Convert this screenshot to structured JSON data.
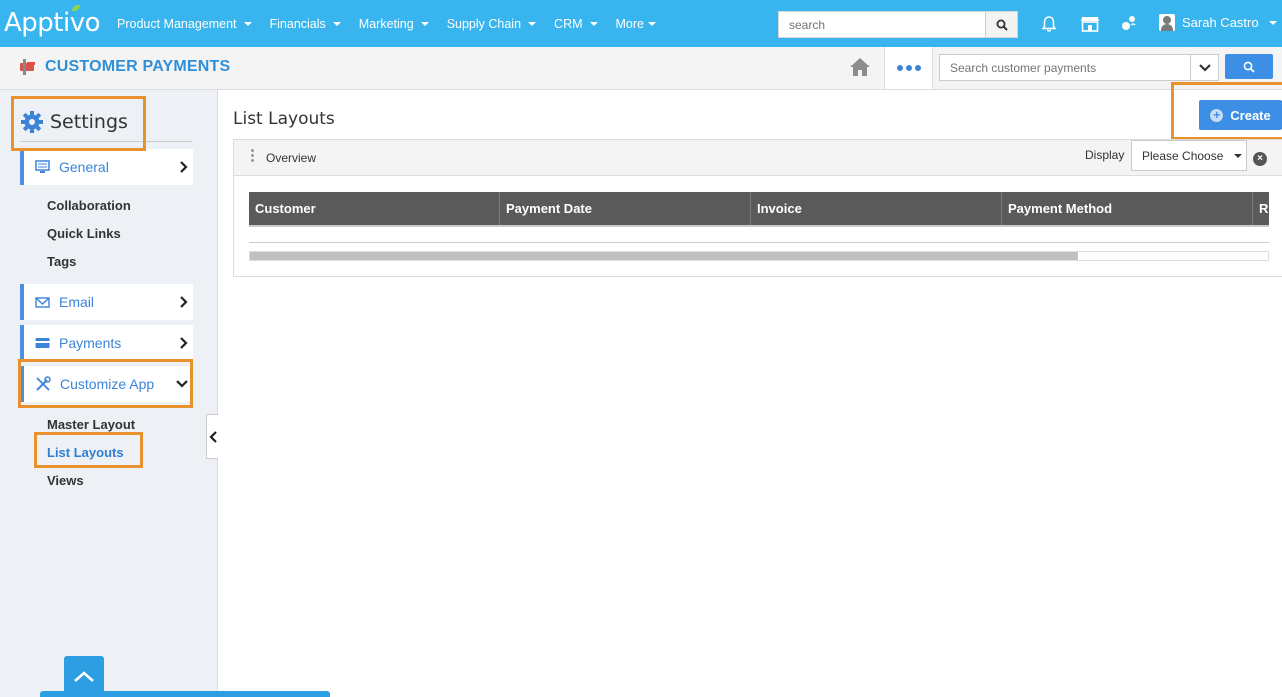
{
  "topbar": {
    "logo": "Apptivo",
    "nav": [
      "Product Management",
      "Financials",
      "Marketing",
      "Supply Chain",
      "CRM",
      "More"
    ],
    "search_placeholder": "search",
    "user_name": "Sarah Castro"
  },
  "subbar": {
    "title": "CUSTOMER PAYMENTS",
    "search_placeholder": "Search customer payments"
  },
  "sidebar": {
    "heading": "Settings",
    "general": "General",
    "general_links": [
      "Collaboration",
      "Quick Links",
      "Tags"
    ],
    "email": "Email",
    "payments": "Payments",
    "customize": "Customize App",
    "customize_links": [
      "Master Layout",
      "List Layouts",
      "Views"
    ]
  },
  "main": {
    "heading": "List Layouts",
    "create_label": "Create",
    "panel_title": "Overview",
    "display_label": "Display",
    "display_value": "Please Choose",
    "columns": [
      "Customer",
      "Payment Date",
      "Invoice",
      "Payment Method",
      "R"
    ]
  },
  "colors": {
    "topbar": "#38b5ee",
    "accent": "#3d8fe6",
    "highlight": "#e8912d"
  }
}
